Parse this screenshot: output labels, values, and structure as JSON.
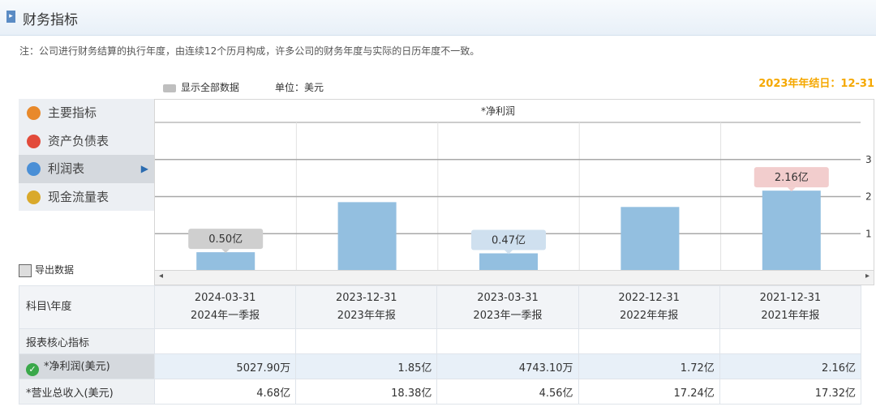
{
  "header": {
    "title": "财务指标"
  },
  "note": "注：公司进行财务结算的执行年度，由连续12个历月构成，许多公司的财务年度与实际的日历年度不一致。",
  "toolbar": {
    "show_all": "显示全部数据",
    "unit": "单位：美元",
    "year_end": "2023年年结日：12-31"
  },
  "menu": {
    "items": [
      {
        "label": "主要指标",
        "icon": "gear-icon",
        "color": "#e8892b"
      },
      {
        "label": "资产负债表",
        "icon": "document-icon",
        "color": "#e24b3b"
      },
      {
        "label": "利润表",
        "icon": "pie-chart-icon",
        "color": "#4a8fd6"
      },
      {
        "label": "现金流量表",
        "icon": "coins-icon",
        "color": "#d9a92b"
      }
    ],
    "active_index": 2
  },
  "export_label": "导出数据",
  "chart_data": {
    "type": "bar",
    "title": "*净利润",
    "categories": [
      "2024-03-31",
      "2023-12-31",
      "2023-03-31",
      "2022-12-31",
      "2021-12-31"
    ],
    "values": [
      0.5,
      1.85,
      0.47,
      1.72,
      2.16
    ],
    "labels": [
      "0.50亿",
      "",
      "0.47亿",
      "",
      "2.16亿"
    ],
    "label_colors": [
      "#cfcfcf",
      "",
      "#cfe0ef",
      "",
      "#f2cdcd"
    ],
    "yticks": [
      "1",
      "2",
      "3"
    ],
    "ylim": [
      0,
      4
    ],
    "bar_color": "#93bfe0"
  },
  "table": {
    "header_label": "科目\\年度",
    "columns": [
      {
        "date": "2024-03-31",
        "period": "2024年一季报"
      },
      {
        "date": "2023-12-31",
        "period": "2023年年报"
      },
      {
        "date": "2023-03-31",
        "period": "2023年一季报"
      },
      {
        "date": "2022-12-31",
        "period": "2022年年报"
      },
      {
        "date": "2021-12-31",
        "period": "2021年年报"
      }
    ],
    "section": "报表核心指标",
    "rows": [
      {
        "label": "*净利润(美元)",
        "values": [
          "5027.90万",
          "1.85亿",
          "4743.10万",
          "1.72亿",
          "2.16亿"
        ]
      },
      {
        "label": "*营业总收入(美元)",
        "values": [
          "4.68亿",
          "18.38亿",
          "4.56亿",
          "17.24亿",
          "17.32亿"
        ]
      }
    ]
  }
}
